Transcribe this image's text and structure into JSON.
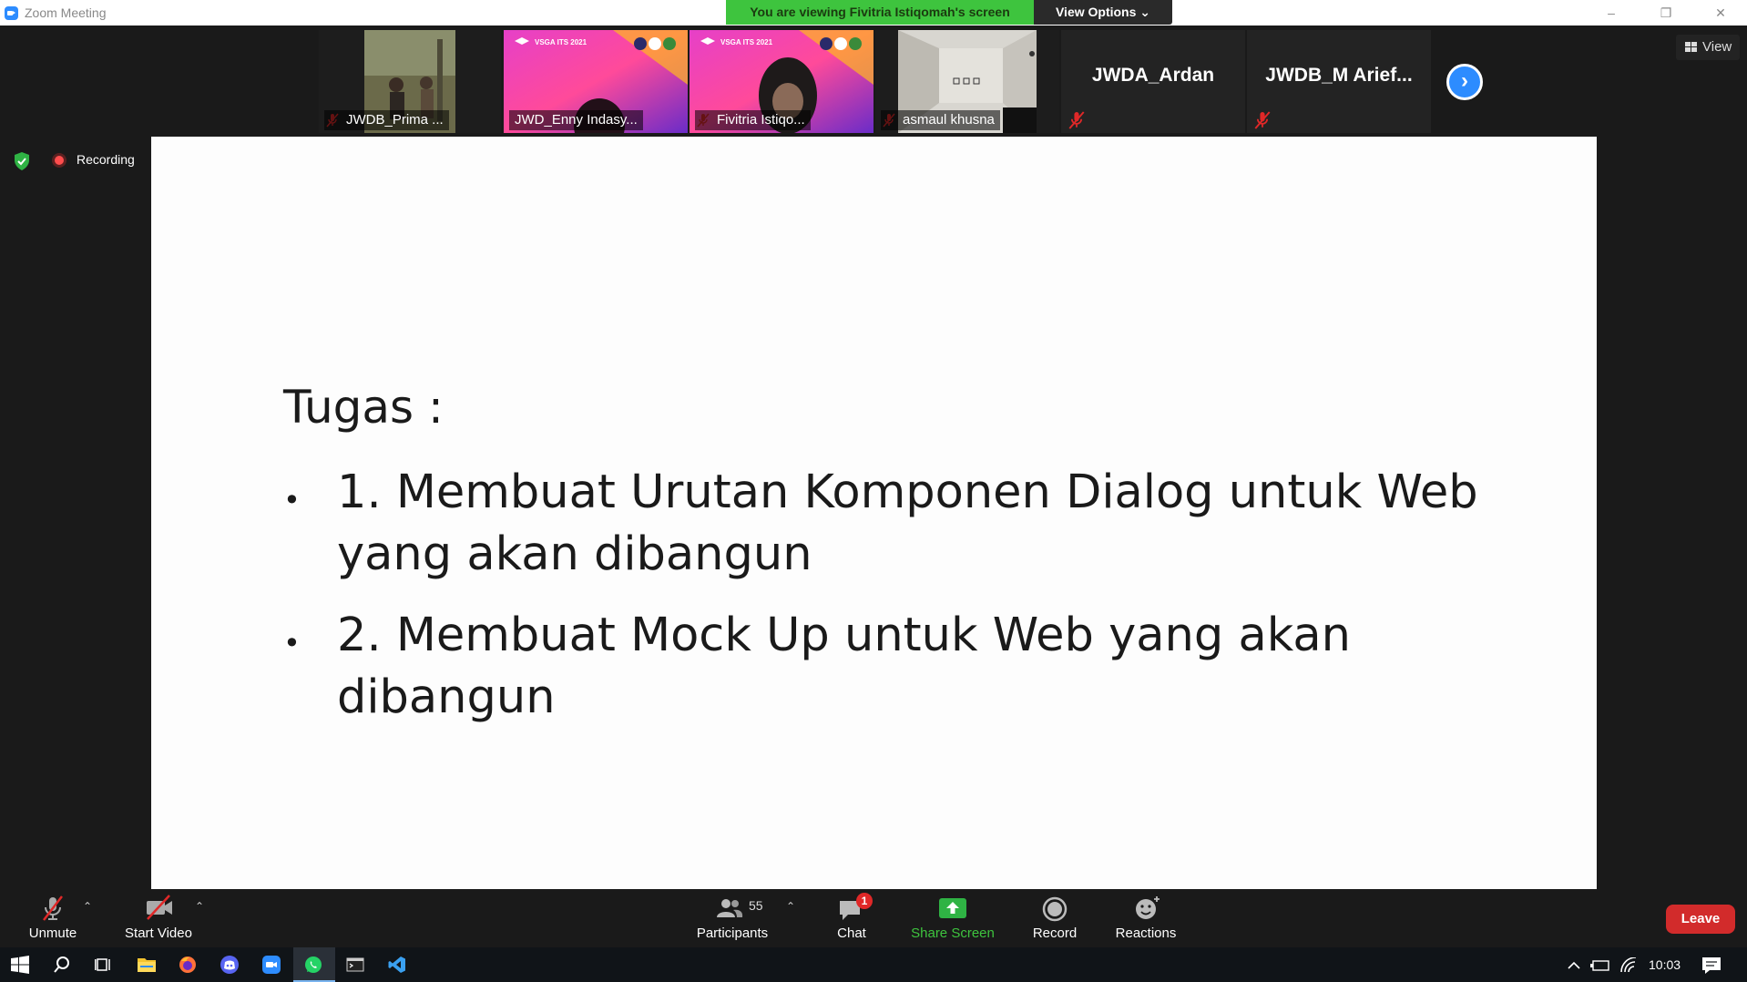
{
  "window": {
    "title": "Zoom Meeting",
    "viewing_banner": "You are viewing Fivitria Istiqomah's screen",
    "view_options": "View Options ⌄",
    "controls": [
      "–",
      "❐",
      "✕"
    ]
  },
  "participants_strip": [
    {
      "name": "JWDB_Prima ...",
      "muted": true,
      "video": "photo"
    },
    {
      "name": "JWD_Enny Indasy...",
      "muted": false,
      "video": "vsga"
    },
    {
      "name": "Fivitria Istiqo...",
      "muted": true,
      "video": "vsga"
    },
    {
      "name": "asmaul khusna",
      "muted": true,
      "video": "room"
    },
    {
      "name": "JWDA_Ardan",
      "muted": true,
      "video": "none"
    },
    {
      "name": "JWDB_M  Arief...",
      "muted": true,
      "video": "none"
    }
  ],
  "vsga_label": "VSGA ITS 2021",
  "view_button": "View",
  "recording_label": "Recording",
  "slide": {
    "title": "Tugas :",
    "bullets": [
      {
        "line1": "1. Membuat Urutan Komponen Dialog untuk Web",
        "line2": "yang akan dibangun"
      },
      {
        "line1": "2. Membuat Mock Up untuk Web yang akan",
        "line2": "dibangun"
      }
    ]
  },
  "toolbar": {
    "unmute": "Unmute",
    "start_video": "Start Video",
    "participants": "Participants",
    "participants_count": "55",
    "chat": "Chat",
    "chat_badge": "1",
    "share_screen": "Share Screen",
    "record": "Record",
    "reactions": "Reactions",
    "leave": "Leave"
  },
  "taskbar": {
    "clock": "10:03"
  },
  "colors": {
    "zoom_blue": "#2d8cff",
    "banner_green": "#3ec43e",
    "leave_red": "#d22b2b",
    "muted_red": "#e02828"
  }
}
